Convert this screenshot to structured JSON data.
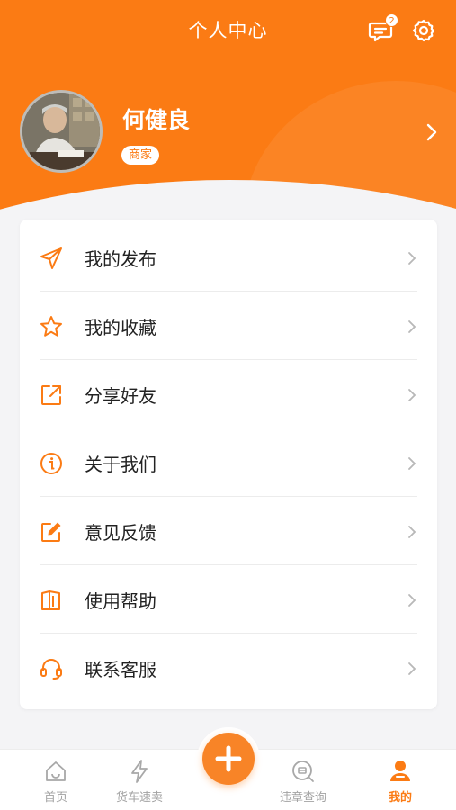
{
  "header": {
    "title": "个人中心",
    "message_count": "2"
  },
  "profile": {
    "name": "何健良",
    "role": "商家"
  },
  "menu": [
    {
      "label": "我的发布",
      "icon": "send-icon"
    },
    {
      "label": "我的收藏",
      "icon": "star-icon"
    },
    {
      "label": "分享好友",
      "icon": "share-icon"
    },
    {
      "label": "关于我们",
      "icon": "info-icon"
    },
    {
      "label": "意见反馈",
      "icon": "edit-icon"
    },
    {
      "label": "使用帮助",
      "icon": "book-icon"
    },
    {
      "label": "联系客服",
      "icon": "headset-icon"
    }
  ],
  "tabbar": {
    "items": [
      {
        "label": "首页",
        "icon": "home-icon"
      },
      {
        "label": "货车速卖",
        "icon": "lightning-icon"
      },
      {
        "label": "违章查询",
        "icon": "search-car-icon"
      },
      {
        "label": "我的",
        "icon": "user-icon",
        "active": true
      }
    ],
    "center_icon": "plus-icon"
  },
  "colors": {
    "brand": "#fb7b14",
    "background": "#f4f4f6",
    "text": "#222222",
    "inactive": "#a3a3a3"
  }
}
